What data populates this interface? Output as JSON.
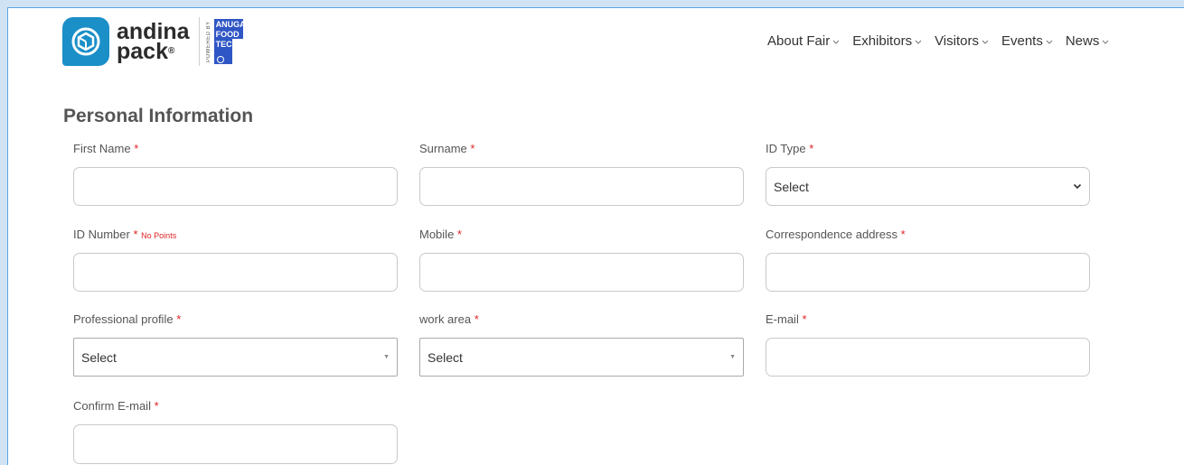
{
  "brand": {
    "name_line1": "andina",
    "name_line2": "pack",
    "registered": "®",
    "powered_by": "POWERED BY",
    "partner_lines": [
      "ANUGA",
      "FOOD",
      "TEC"
    ],
    "accent": "#1a8fc8",
    "partner_color": "#2f56c5"
  },
  "nav": {
    "items": [
      {
        "label": "About Fair",
        "icon": "chevron-down-icon"
      },
      {
        "label": "Exhibitors",
        "icon": "chevron-down-icon"
      },
      {
        "label": "Visitors",
        "icon": "chevron-down-icon"
      },
      {
        "label": "Events",
        "icon": "chevron-down-icon"
      },
      {
        "label": "News",
        "icon": "chevron-down-icon"
      }
    ]
  },
  "form": {
    "title": "Personal Information",
    "required_mark": "*",
    "required_color": "#e02424",
    "fields": {
      "first_name": {
        "label": "First Name",
        "value": ""
      },
      "surname": {
        "label": "Surname",
        "value": ""
      },
      "id_type": {
        "label": "ID Type",
        "selected": "Select"
      },
      "id_number": {
        "label": "ID Number",
        "hint": "No Points",
        "value": ""
      },
      "mobile": {
        "label": "Mobile",
        "value": ""
      },
      "address": {
        "label": "Correspondence address",
        "value": ""
      },
      "profile": {
        "label": "Professional profile",
        "selected": "Select"
      },
      "work_area": {
        "label": "work area",
        "selected": "Select"
      },
      "email": {
        "label": "E-mail",
        "value": ""
      },
      "confirm_email": {
        "label": "Confirm E-mail",
        "value": ""
      }
    }
  }
}
